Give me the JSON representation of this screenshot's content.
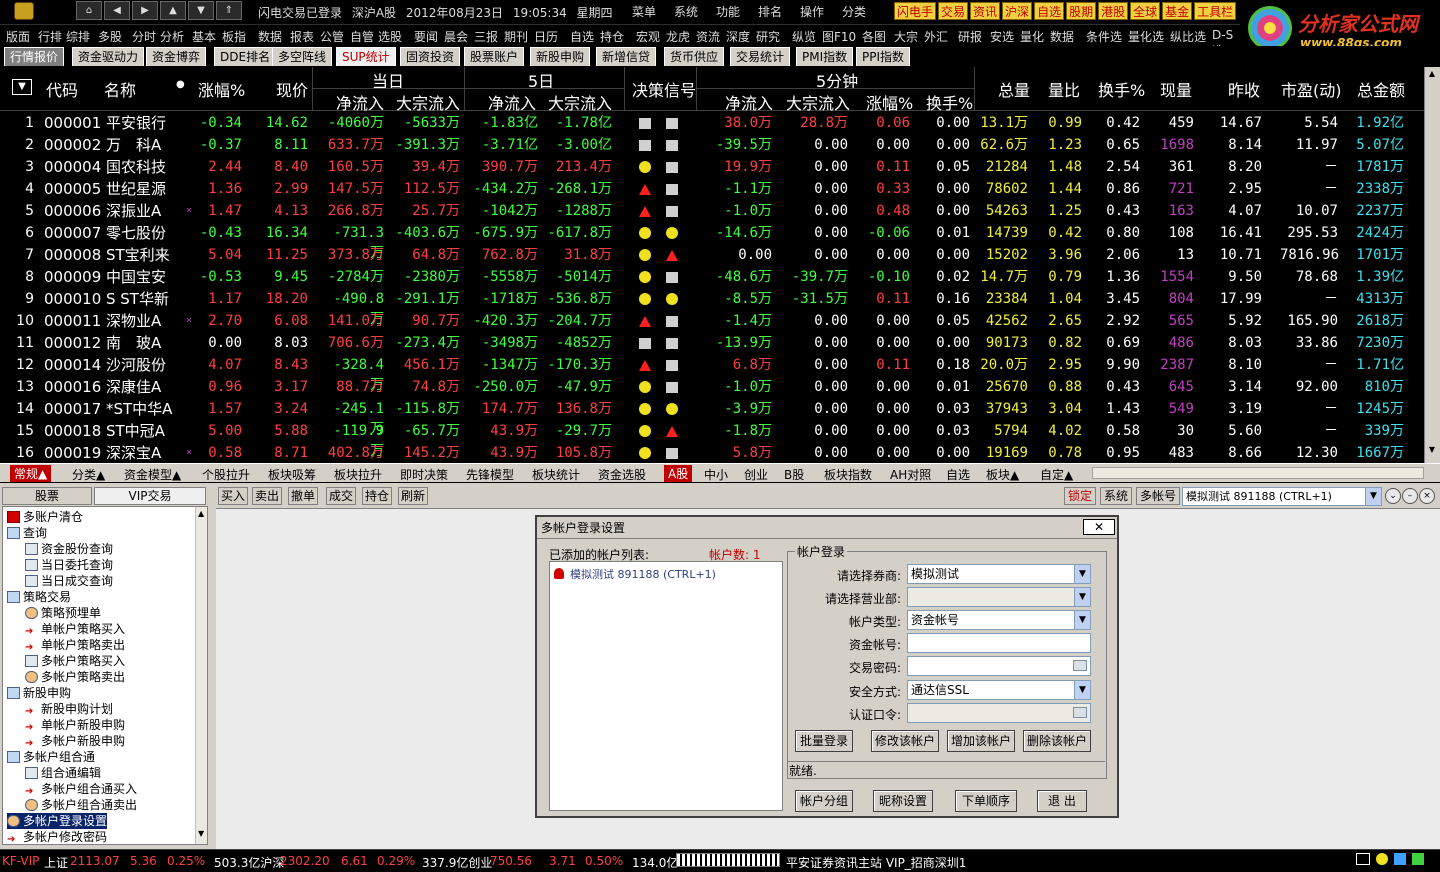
{
  "titlebar": {
    "status_login": "闪电交易已登录",
    "status_board": "深沪A股",
    "status_date": "2012年08月23日",
    "status_time": "19:05:34",
    "status_weekday": "星期四",
    "menus": [
      "菜单",
      "系统",
      "功能",
      "排名",
      "操作",
      "分类"
    ],
    "quick": [
      "闪电手",
      "交易",
      "资讯",
      "沪深",
      "自选",
      "股期",
      "港股",
      "全球",
      "基金",
      "工具栏"
    ]
  },
  "brand": {
    "name": "分析家公式网",
    "url": "www.88gs.com"
  },
  "toolbar2": [
    "版面",
    "行排",
    "综排",
    "多股",
    "分时",
    "分析",
    "基本",
    "板指",
    "数据",
    "报表",
    "公管",
    "自管",
    "选股",
    "要闻",
    "晨会",
    "三报",
    "期刊",
    "日历",
    "自选",
    "持仓",
    "宏观",
    "龙虎",
    "资流",
    "深度",
    "研究",
    "纵览",
    "图F10",
    "各图",
    "大宗",
    "外汇",
    "研报",
    "安选",
    "量化",
    "数据",
    "条件选",
    "量化选",
    "纵比选",
    "D-S选"
  ],
  "tabs": [
    "行情报价",
    "资金驱动力",
    "资金博弈",
    "DDE排名",
    "多空阵线",
    "SUP统计",
    "固资投资",
    "股票账户",
    "新股申购",
    "新增信贷",
    "货币供应",
    "交易统计",
    "PMI指数",
    "PPI指数"
  ],
  "active_tab_index": 5,
  "grid_header": {
    "sort": "▼",
    "code": "代码",
    "name": "名称",
    "change_pct": "涨幅%",
    "price": "现价",
    "today": "当日",
    "five_day": "5日",
    "signal": "决策信号",
    "five_min": "5分钟",
    "inflow": "净流入",
    "block_inflow": "大宗流入",
    "m_change": "涨幅%",
    "m_turnover": "换手%",
    "total_vol": "总量",
    "vol_ratio": "量比",
    "turnover": "换手%",
    "cur_vol": "现量",
    "prev_close": "昨收",
    "pe": "市盈(动)",
    "amount": "总金额"
  },
  "rows": [
    {
      "no": "1",
      "code": "000001",
      "name": "平安银行",
      "mark": "",
      "chg": "-0.34",
      "price": "14.62",
      "in1": "-4060万",
      "blk1": "-5633万",
      "in5": "-1.83亿",
      "blk5": "-1.78亿",
      "s1": "sq",
      "s2": "sq",
      "m_in": "38.0万",
      "m_blk": "28.8万",
      "m_chg": "0.06",
      "m_to": "0.00",
      "vol": "13.1万",
      "vr": "0.99",
      "to": "0.42",
      "cv": "459",
      "prev": "14.67",
      "pe": "5.54",
      "amt": "1.92亿"
    },
    {
      "no": "2",
      "code": "000002",
      "name": "万　科A",
      "mark": "",
      "chg": "-0.37",
      "price": "8.11",
      "in1": "633.7万",
      "blk1": "-391.3万",
      "in5": "-3.71亿",
      "blk5": "-3.00亿",
      "s1": "sq",
      "s2": "sq",
      "m_in": "-39.5万",
      "m_blk": "0.00",
      "m_chg": "0.00",
      "m_to": "0.00",
      "vol": "62.6万",
      "vr": "1.23",
      "to": "0.65",
      "cv": "1698",
      "prev": "8.14",
      "pe": "11.97",
      "amt": "5.07亿"
    },
    {
      "no": "3",
      "code": "000004",
      "name": "国农科技",
      "mark": "",
      "chg": "2.44",
      "price": "8.40",
      "in1": "160.5万",
      "blk1": "39.4万",
      "in5": "390.7万",
      "blk5": "213.4万",
      "s1": "dot",
      "s2": "sq",
      "m_in": "19.9万",
      "m_blk": "0.00",
      "m_chg": "0.11",
      "m_to": "0.05",
      "vol": "21284",
      "vr": "1.48",
      "to": "2.54",
      "cv": "361",
      "prev": "8.20",
      "pe": "－",
      "amt": "1781万"
    },
    {
      "no": "4",
      "code": "000005",
      "name": "世纪星源",
      "mark": "",
      "chg": "1.36",
      "price": "2.99",
      "in1": "147.5万",
      "blk1": "112.5万",
      "in5": "-434.2万",
      "blk5": "-268.1万",
      "s1": "tri",
      "s2": "sq",
      "m_in": "-1.1万",
      "m_blk": "0.00",
      "m_chg": "0.33",
      "m_to": "0.00",
      "vol": "78602",
      "vr": "1.44",
      "to": "0.86",
      "cv": "721",
      "prev": "2.95",
      "pe": "－",
      "amt": "2338万"
    },
    {
      "no": "5",
      "code": "000006",
      "name": "深振业A",
      "mark": "×",
      "chg": "1.47",
      "price": "4.13",
      "in1": "266.8万",
      "blk1": "25.7万",
      "in5": "-1042万",
      "blk5": "-1288万",
      "s1": "tri",
      "s2": "sq",
      "m_in": "-1.0万",
      "m_blk": "0.00",
      "m_chg": "0.48",
      "m_to": "0.00",
      "vol": "54263",
      "vr": "1.25",
      "to": "0.43",
      "cv": "163",
      "prev": "4.07",
      "pe": "10.07",
      "amt": "2237万"
    },
    {
      "no": "6",
      "code": "000007",
      "name": "零七股份",
      "mark": "",
      "chg": "-0.43",
      "price": "16.34",
      "in1": "-731.3万",
      "blk1": "-403.6万",
      "in5": "-675.9万",
      "blk5": "-617.8万",
      "s1": "dot",
      "s2": "dot",
      "m_in": "-14.6万",
      "m_blk": "0.00",
      "m_chg": "-0.06",
      "m_to": "0.01",
      "vol": "14739",
      "vr": "0.42",
      "to": "0.80",
      "cv": "108",
      "prev": "16.41",
      "pe": "295.53",
      "amt": "2424万"
    },
    {
      "no": "7",
      "code": "000008",
      "name": "ST宝利来",
      "mark": "",
      "chg": "5.04",
      "price": "11.25",
      "in1": "373.8万",
      "blk1": "64.8万",
      "in5": "762.8万",
      "blk5": "31.8万",
      "s1": "dot",
      "s2": "tri",
      "m_in": "0.00",
      "m_blk": "0.00",
      "m_chg": "0.00",
      "m_to": "0.00",
      "vol": "15202",
      "vr": "3.96",
      "to": "2.06",
      "cv": "13",
      "prev": "10.71",
      "pe": "7816.96",
      "amt": "1701万"
    },
    {
      "no": "8",
      "code": "000009",
      "name": "中国宝安",
      "mark": "",
      "chg": "-0.53",
      "price": "9.45",
      "in1": "-2784万",
      "blk1": "-2380万",
      "in5": "-5558万",
      "blk5": "-5014万",
      "s1": "dot",
      "s2": "sq",
      "m_in": "-48.6万",
      "m_blk": "-39.7万",
      "m_chg": "-0.10",
      "m_to": "0.02",
      "vol": "14.7万",
      "vr": "0.79",
      "to": "1.36",
      "cv": "1554",
      "prev": "9.50",
      "pe": "78.68",
      "amt": "1.39亿"
    },
    {
      "no": "9",
      "code": "000010",
      "name": "S ST华新",
      "mark": "",
      "chg": "1.17",
      "price": "18.20",
      "in1": "-490.8万",
      "blk1": "-291.1万",
      "in5": "-1718万",
      "blk5": "-536.8万",
      "s1": "dot",
      "s2": "dot",
      "m_in": "-8.5万",
      "m_blk": "-31.5万",
      "m_chg": "0.11",
      "m_to": "0.16",
      "vol": "23384",
      "vr": "1.04",
      "to": "3.45",
      "cv": "804",
      "prev": "17.99",
      "pe": "－",
      "amt": "4313万"
    },
    {
      "no": "10",
      "code": "000011",
      "name": "深物业A",
      "mark": "×",
      "chg": "2.70",
      "price": "6.08",
      "in1": "141.0万",
      "blk1": "90.7万",
      "in5": "-420.3万",
      "blk5": "-204.7万",
      "s1": "tri",
      "s2": "sq",
      "m_in": "-1.4万",
      "m_blk": "0.00",
      "m_chg": "0.00",
      "m_to": "0.05",
      "vol": "42562",
      "vr": "2.65",
      "to": "2.92",
      "cv": "565",
      "prev": "5.92",
      "pe": "165.90",
      "amt": "2618万"
    },
    {
      "no": "11",
      "code": "000012",
      "name": "南　玻A",
      "mark": "",
      "chg": "0.00",
      "price": "8.03",
      "in1": "706.6万",
      "blk1": "-273.4万",
      "in5": "-3498万",
      "blk5": "-4852万",
      "s1": "sq",
      "s2": "sq",
      "m_in": "-13.9万",
      "m_blk": "0.00",
      "m_chg": "0.00",
      "m_to": "0.00",
      "vol": "90173",
      "vr": "0.82",
      "to": "0.69",
      "cv": "486",
      "prev": "8.03",
      "pe": "33.86",
      "amt": "7230万"
    },
    {
      "no": "12",
      "code": "000014",
      "name": "沙河股份",
      "mark": "",
      "chg": "4.07",
      "price": "8.43",
      "in1": "-328.4万",
      "blk1": "456.1万",
      "in5": "-1347万",
      "blk5": "-170.3万",
      "s1": "tri",
      "s2": "sq",
      "m_in": "6.8万",
      "m_blk": "0.00",
      "m_chg": "0.11",
      "m_to": "0.18",
      "vol": "20.0万",
      "vr": "2.95",
      "to": "9.90",
      "cv": "2387",
      "prev": "8.10",
      "pe": "－",
      "amt": "1.71亿"
    },
    {
      "no": "13",
      "code": "000016",
      "name": "深康佳A",
      "mark": "",
      "chg": "0.96",
      "price": "3.17",
      "in1": "88.7万",
      "blk1": "74.8万",
      "in5": "-250.0万",
      "blk5": "-47.9万",
      "s1": "dot",
      "s2": "sq",
      "m_in": "-1.0万",
      "m_blk": "0.00",
      "m_chg": "0.00",
      "m_to": "0.01",
      "vol": "25670",
      "vr": "0.88",
      "to": "0.43",
      "cv": "645",
      "prev": "3.14",
      "pe": "92.00",
      "amt": "810万"
    },
    {
      "no": "14",
      "code": "000017",
      "name": "*ST中华A",
      "mark": "",
      "chg": "1.57",
      "price": "3.24",
      "in1": "-245.1万",
      "blk1": "-115.8万",
      "in5": "174.7万",
      "blk5": "136.8万",
      "s1": "dot",
      "s2": "dot",
      "m_in": "-3.9万",
      "m_blk": "0.00",
      "m_chg": "0.00",
      "m_to": "0.03",
      "vol": "37943",
      "vr": "3.04",
      "to": "1.43",
      "cv": "549",
      "prev": "3.19",
      "pe": "－",
      "amt": "1245万"
    },
    {
      "no": "15",
      "code": "000018",
      "name": "ST中冠A",
      "mark": "",
      "chg": "5.00",
      "price": "5.88",
      "in1": "-119.9万",
      "blk1": "-65.7万",
      "in5": "43.9万",
      "blk5": "-29.7万",
      "s1": "dot",
      "s2": "tri",
      "m_in": "-1.8万",
      "m_blk": "0.00",
      "m_chg": "0.00",
      "m_to": "0.03",
      "vol": "5794",
      "vr": "4.02",
      "to": "0.58",
      "cv": "30",
      "prev": "5.60",
      "pe": "－",
      "amt": "339万"
    },
    {
      "no": "16",
      "code": "000019",
      "name": "深深宝A",
      "mark": "×",
      "chg": "0.58",
      "price": "8.71",
      "in1": "402.8万",
      "blk1": "145.2万",
      "in5": "43.9万",
      "blk5": "105.8万",
      "s1": "dot",
      "s2": "sq",
      "m_in": "5.8万",
      "m_blk": "0.00",
      "m_chg": "0.00",
      "m_to": "0.00",
      "vol": "19169",
      "vr": "0.78",
      "to": "0.95",
      "cv": "483",
      "prev": "8.66",
      "pe": "12.30",
      "amt": "1667万"
    }
  ],
  "bottom_tabs": [
    "常规▲",
    "分类▲",
    "资金模型▲",
    "个股拉升",
    "板块吸筹",
    "板块拉升",
    "即时决策",
    "先锋模型",
    "板块统计",
    "资金选股",
    "A股",
    "中小",
    "创业",
    "B股",
    "板块指数",
    "AH对照",
    "自选",
    "板块▲",
    "自定▲"
  ],
  "lower": {
    "left_tabs": [
      "股票",
      "VIP交易"
    ],
    "tree": [
      {
        "label": "多账户清仓",
        "icon": "sell",
        "lvl": 0
      },
      {
        "label": "查询",
        "icon": "folder",
        "lvl": 0
      },
      {
        "label": "资金股份查询",
        "icon": "doc",
        "lvl": 1
      },
      {
        "label": "当日委托查询",
        "icon": "doc",
        "lvl": 1
      },
      {
        "label": "当日成交查询",
        "icon": "doc",
        "lvl": 1
      },
      {
        "label": "策略交易",
        "icon": "folder",
        "lvl": 0
      },
      {
        "label": "策略预埋单",
        "icon": "person",
        "lvl": 1
      },
      {
        "label": "单帐户策略买入",
        "icon": "arrow",
        "lvl": 1
      },
      {
        "label": "单帐户策略卖出",
        "icon": "arrow",
        "lvl": 1
      },
      {
        "label": "多帐户策略买入",
        "icon": "doc",
        "lvl": 1
      },
      {
        "label": "多帐户策略卖出",
        "icon": "person",
        "lvl": 1
      },
      {
        "label": "新股申购",
        "icon": "folder",
        "lvl": 0
      },
      {
        "label": "新股申购计划",
        "icon": "arrow",
        "lvl": 1
      },
      {
        "label": "单帐户新股申购",
        "icon": "arrow",
        "lvl": 1
      },
      {
        "label": "多帐户新股申购",
        "icon": "arrow",
        "lvl": 1
      },
      {
        "label": "多帐户组合通",
        "icon": "folder",
        "lvl": 0
      },
      {
        "label": "组合通编辑",
        "icon": "doc",
        "lvl": 1
      },
      {
        "label": "多帐户组合通买入",
        "icon": "arrow",
        "lvl": 1
      },
      {
        "label": "多帐户组合通卖出",
        "icon": "person",
        "lvl": 1
      },
      {
        "label": "多帐户登录设置",
        "icon": "person",
        "lvl": 0,
        "selected": true
      },
      {
        "label": "多帐户修改密码",
        "icon": "arrow",
        "lvl": 0
      }
    ],
    "action_buttons": [
      "买入",
      "卖出",
      "撤单",
      "成交",
      "持仓",
      "刷新"
    ],
    "right_buttons": [
      "锁定",
      "系统",
      "多帐号"
    ],
    "account_select": "模拟测试 891188 (CTRL+1)"
  },
  "dialog": {
    "title": "多帐户登录设置",
    "list_label": "已添加的帐户列表:",
    "count_label": "帐户数: 1",
    "list_item": "模拟测试 891188 (CTRL+1)",
    "group_label": "帐户登录",
    "fields": [
      {
        "label": "请选择券商:",
        "value": "模拟测试",
        "type": "select"
      },
      {
        "label": "请选择营业部:",
        "value": "",
        "type": "select-disabled"
      },
      {
        "label": "帐户类型:",
        "value": "资金帐号",
        "type": "select"
      },
      {
        "label": "资金帐号:",
        "value": "",
        "type": "text"
      },
      {
        "label": "交易密码:",
        "value": "",
        "type": "password"
      },
      {
        "label": "安全方式:",
        "value": "通达信SSL",
        "type": "select"
      },
      {
        "label": "认证口令:",
        "value": "",
        "type": "password-disabled"
      }
    ],
    "row_buttons": [
      "批量登录",
      "修改该帐户",
      "增加该帐户",
      "删除该帐户"
    ],
    "status": "就绪.",
    "bottom_buttons": [
      "帐户分组",
      "昵称设置",
      "下单顺序",
      "退 出"
    ]
  },
  "statusbar": {
    "label": "KF-VIP",
    "sh_name": "上证",
    "sh_val": "2113.07",
    "sh_chg": "5.36",
    "sh_pct": "0.25%",
    "sh_amt": "503.3亿沪深",
    "sz_val": "2302.20",
    "sz_chg": "6.61",
    "sz_pct": "0.29%",
    "sz_amt": "337.9亿创业",
    "cy_val": "750.56",
    "cy_chg": "3.71",
    "cy_pct": "0.50%",
    "cy_amt": "134.0亿",
    "info": "平安证券资讯主站 VIP_招商深圳1"
  }
}
